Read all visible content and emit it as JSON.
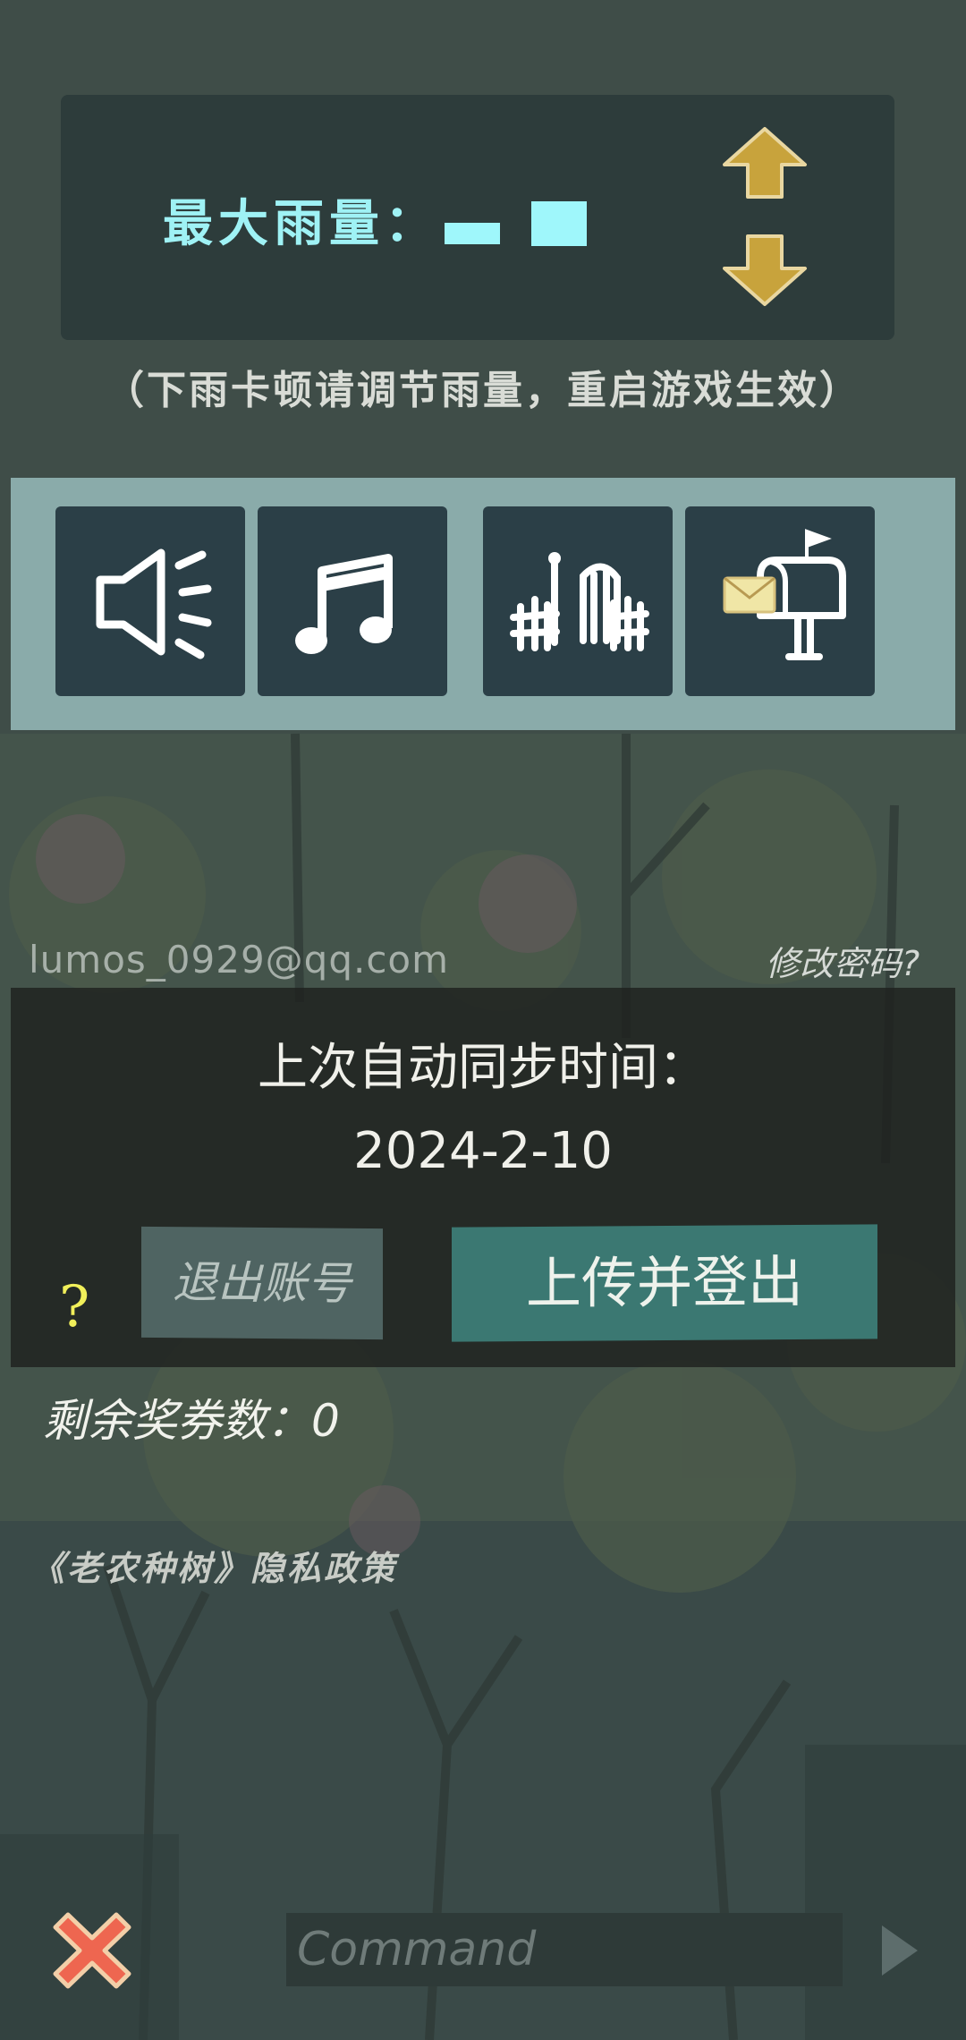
{
  "rain": {
    "label": "最大雨量：",
    "level": 2,
    "hint": "（下雨卡顿请调节雨量，重启游戏生效）",
    "up_icon": "arrow-up-icon",
    "down_icon": "arrow-down-icon"
  },
  "icons": [
    {
      "name": "sound-icon"
    },
    {
      "name": "music-icon"
    },
    {
      "name": "fence-gate-icon"
    },
    {
      "name": "mailbox-icon"
    }
  ],
  "account": {
    "email": "lumos_0929@qq.com",
    "change_password": "修改密码?",
    "sync_title": "上次自动同步时间：",
    "sync_date": "2024-2-10",
    "help": "?",
    "logout_label": "退出账号",
    "upload_label": "上传并登出"
  },
  "tickets": "剩余奖券数：0",
  "privacy": "《老农种树》隐私政策",
  "command": {
    "placeholder": "Command",
    "value": ""
  },
  "colors": {
    "panel": "#2d3c3b",
    "accent_cyan": "#9ff7fb",
    "arrow_gold": "#c8a33c",
    "upload_teal": "#3b7872",
    "close_red": "#ee6650"
  }
}
